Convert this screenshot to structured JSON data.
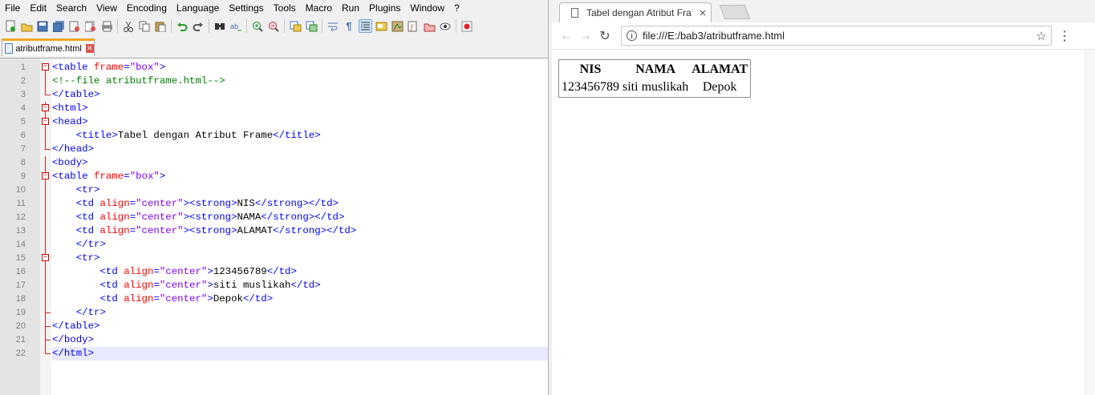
{
  "npp": {
    "menu": [
      "File",
      "Edit",
      "Search",
      "View",
      "Encoding",
      "Language",
      "Settings",
      "Tools",
      "Macro",
      "Run",
      "Plugins",
      "Window",
      "?"
    ],
    "tab": {
      "filename": "atributframe.html",
      "close": "✕"
    },
    "code_lines": [
      [
        [
          "tag",
          "<table "
        ],
        [
          "attr",
          "frame"
        ],
        [
          "tag",
          "="
        ],
        [
          "str",
          "\"box\""
        ],
        [
          "tag",
          ">"
        ]
      ],
      [
        [
          "cmt",
          "<!--file atributframe.html-->"
        ]
      ],
      [
        [
          "tag",
          "</table>"
        ]
      ],
      [
        [
          "tag",
          "<html>"
        ]
      ],
      [
        [
          "tag",
          "<head>"
        ]
      ],
      [
        [
          "txt",
          "    "
        ],
        [
          "tag",
          "<title>"
        ],
        [
          "txt",
          "Tabel dengan Atribut Frame"
        ],
        [
          "tag",
          "</title>"
        ]
      ],
      [
        [
          "tag",
          "</head>"
        ]
      ],
      [
        [
          "tag",
          "<body>"
        ]
      ],
      [
        [
          "tag",
          "<table "
        ],
        [
          "attr",
          "frame"
        ],
        [
          "tag",
          "="
        ],
        [
          "str",
          "\"box\""
        ],
        [
          "tag",
          ">"
        ]
      ],
      [
        [
          "txt",
          "    "
        ],
        [
          "tag",
          "<tr>"
        ]
      ],
      [
        [
          "txt",
          "    "
        ],
        [
          "tag",
          "<td "
        ],
        [
          "attr",
          "align"
        ],
        [
          "tag",
          "="
        ],
        [
          "str",
          "\"center\""
        ],
        [
          "tag",
          "><strong>"
        ],
        [
          "txt",
          "NIS"
        ],
        [
          "tag",
          "</strong></td>"
        ]
      ],
      [
        [
          "txt",
          "    "
        ],
        [
          "tag",
          "<td "
        ],
        [
          "attr",
          "align"
        ],
        [
          "tag",
          "="
        ],
        [
          "str",
          "\"center\""
        ],
        [
          "tag",
          "><strong>"
        ],
        [
          "txt",
          "NAMA"
        ],
        [
          "tag",
          "</strong></td>"
        ]
      ],
      [
        [
          "txt",
          "    "
        ],
        [
          "tag",
          "<td "
        ],
        [
          "attr",
          "align"
        ],
        [
          "tag",
          "="
        ],
        [
          "str",
          "\"center\""
        ],
        [
          "tag",
          "><strong>"
        ],
        [
          "txt",
          "ALAMAT"
        ],
        [
          "tag",
          "</strong></td>"
        ]
      ],
      [
        [
          "txt",
          "    "
        ],
        [
          "tag",
          "</tr>"
        ]
      ],
      [
        [
          "txt",
          "    "
        ],
        [
          "tag",
          "<tr>"
        ]
      ],
      [
        [
          "txt",
          "        "
        ],
        [
          "tag",
          "<td "
        ],
        [
          "attr",
          "align"
        ],
        [
          "tag",
          "="
        ],
        [
          "str",
          "\"center\""
        ],
        [
          "tag",
          ">"
        ],
        [
          "txt",
          "123456789"
        ],
        [
          "tag",
          "</td>"
        ]
      ],
      [
        [
          "txt",
          "        "
        ],
        [
          "tag",
          "<td "
        ],
        [
          "attr",
          "align"
        ],
        [
          "tag",
          "="
        ],
        [
          "str",
          "\"center\""
        ],
        [
          "tag",
          ">"
        ],
        [
          "txt",
          "siti muslikah"
        ],
        [
          "tag",
          "</td>"
        ]
      ],
      [
        [
          "txt",
          "        "
        ],
        [
          "tag",
          "<td "
        ],
        [
          "attr",
          "align"
        ],
        [
          "tag",
          "="
        ],
        [
          "str",
          "\"center\""
        ],
        [
          "tag",
          ">"
        ],
        [
          "txt",
          "Depok"
        ],
        [
          "tag",
          "</td>"
        ]
      ],
      [
        [
          "txt",
          "    "
        ],
        [
          "tag",
          "</tr>"
        ]
      ],
      [
        [
          "tag",
          "</table>"
        ]
      ],
      [
        [
          "tag",
          "</body>"
        ]
      ],
      [
        [
          "tag",
          "</html>"
        ]
      ]
    ],
    "line_numbers": [
      "1",
      "2",
      "3",
      "4",
      "5",
      "6",
      "7",
      "8",
      "9",
      "10",
      "11",
      "12",
      "13",
      "14",
      "15",
      "16",
      "17",
      "18",
      "19",
      "20",
      "21",
      "22"
    ],
    "fold": [
      "box",
      "v",
      "end",
      "box",
      "box",
      "v",
      "end",
      "v",
      "box",
      "v",
      "v",
      "v",
      "v",
      "v",
      "box",
      "v",
      "v",
      "v",
      "end",
      "end",
      "end",
      "end"
    ],
    "current_line": 21,
    "colors": {
      "tag": "#0000ff",
      "attr": "#ff0000",
      "string": "#8000ff",
      "comment": "#008000",
      "fold": "#e02020",
      "current_line": "#e8e8ff"
    }
  },
  "browser": {
    "tab_title": "Tabel dengan Atribut Fra",
    "tab_close": "×",
    "url": "file:///E:/bab3/atributframe.html",
    "table": {
      "headers": [
        "NIS",
        "NAMA",
        "ALAMAT"
      ],
      "rows": [
        [
          "123456789",
          "siti muslikah",
          "Depok"
        ]
      ]
    }
  }
}
